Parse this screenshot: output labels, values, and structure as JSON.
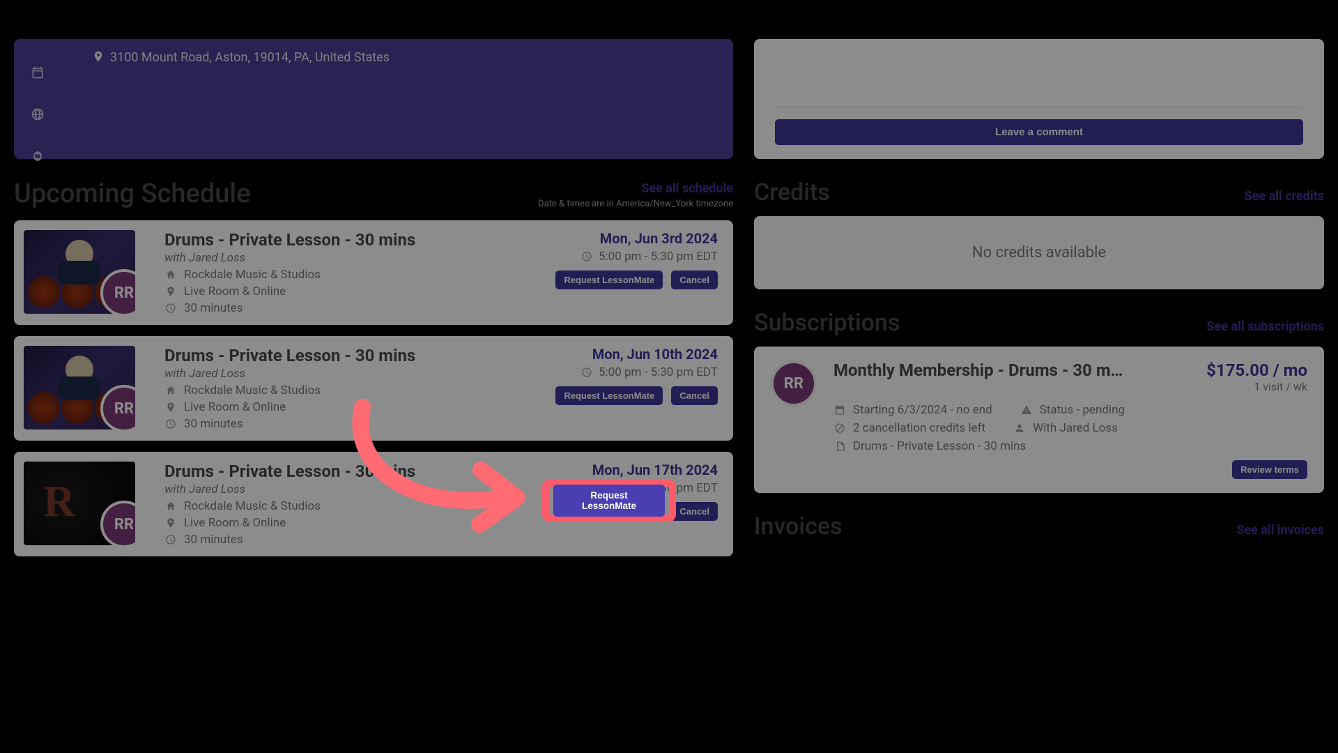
{
  "banner": {
    "address": "3100 Mount Road, Aston, 19014, PA, United States"
  },
  "sidebar": {
    "icons": [
      "calendar-icon",
      "globe-icon",
      "refresh-icon"
    ]
  },
  "sections": {
    "upcoming_title": "Upcoming Schedule",
    "see_all_schedule": "See all schedule",
    "tz_note": "Date & times are in America/New_York timezone",
    "credits_title": "Credits",
    "see_all_credits": "See all credits",
    "no_credits": "No credits available",
    "subs_title": "Subscriptions",
    "see_all_subs": "See all subscriptions",
    "invoices_title": "Invoices",
    "see_all_invoices": "See all invoices"
  },
  "comment": {
    "leave_comment": "Leave a comment"
  },
  "lessons": [
    {
      "title": "Drums - Private Lesson - 30 mins",
      "with": "with Jared Loss",
      "studio": "Rockdale Music & Studios",
      "location": "Live Room & Online",
      "duration": "30 minutes",
      "date": "Mon, Jun 3rd 2024",
      "time": "5:00 pm - 5:30 pm EDT",
      "initials": "RR",
      "request": "Request LessonMate",
      "cancel": "Cancel",
      "thumb_variant": "drums"
    },
    {
      "title": "Drums - Private Lesson - 30 mins",
      "with": "with Jared Loss",
      "studio": "Rockdale Music & Studios",
      "location": "Live Room & Online",
      "duration": "30 minutes",
      "date": "Mon, Jun 10th 2024",
      "time": "5:00 pm - 5:30 pm EDT",
      "initials": "RR",
      "request": "Request LessonMate",
      "cancel": "Cancel",
      "thumb_variant": "drums"
    },
    {
      "title": "Drums - Private Lesson - 30 mins",
      "with": "with Jared Loss",
      "studio": "Rockdale Music & Studios",
      "location": "Live Room & Online",
      "duration": "30 minutes",
      "date": "Mon, Jun 17th 2024",
      "time": "5:00 pm - 5:30 pm EDT",
      "initials": "RR",
      "request": "Request LessonMate",
      "cancel": "Cancel",
      "thumb_variant": "dark-r"
    }
  ],
  "subscription": {
    "initials": "RR",
    "title": "Monthly Membership - Drums - 30 m…",
    "price": "$175.00 / mo",
    "visits": "1 visit / wk",
    "starting": "Starting 6/3/2024 - no end",
    "status": "Status - pending",
    "credits": "2 cancellation credits left",
    "with": "With Jared Loss",
    "product": "Drums - Private Lesson - 30 mins",
    "review": "Review terms"
  },
  "annotation": {
    "highlighted_request": "Request LessonMate"
  }
}
